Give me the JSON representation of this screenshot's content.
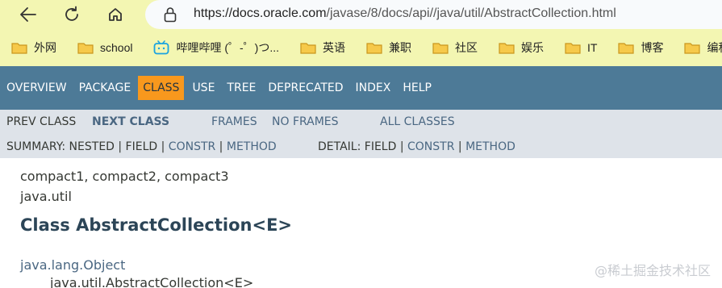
{
  "browser": {
    "url_host": "https://docs.oracle.com",
    "url_path": "/javase/8/docs/api//java/util/AbstractCollection.html",
    "back_icon": "arrow-left-icon",
    "reload_icon": "reload-icon",
    "home_icon": "home-icon",
    "lock_icon": "lock-icon"
  },
  "bookmarks": [
    {
      "label": "外网",
      "icon": "folder-icon"
    },
    {
      "label": "school",
      "icon": "folder-icon"
    },
    {
      "label": "哔哩哔哩 (゜-゜)つ...",
      "icon": "bilibili-icon"
    },
    {
      "label": "英语",
      "icon": "folder-icon"
    },
    {
      "label": "兼职",
      "icon": "folder-icon"
    },
    {
      "label": "社区",
      "icon": "folder-icon"
    },
    {
      "label": "娱乐",
      "icon": "folder-icon"
    },
    {
      "label": "IT",
      "icon": "folder-icon"
    },
    {
      "label": "博客",
      "icon": "folder-icon"
    },
    {
      "label": "编程",
      "icon": "folder-icon"
    }
  ],
  "topnav": {
    "overview": "OVERVIEW",
    "package": "PACKAGE",
    "class": "CLASS",
    "use": "USE",
    "tree": "TREE",
    "deprecated": "DEPRECATED",
    "index": "INDEX",
    "help": "HELP"
  },
  "subnav": {
    "prev_class": "PREV CLASS",
    "next_class": "NEXT CLASS",
    "frames": "FRAMES",
    "no_frames": "NO FRAMES",
    "all_classes": "ALL CLASSES",
    "summary_prefix": "SUMMARY: NESTED | FIELD | ",
    "summary_constr": "CONSTR",
    "summary_sep": " | ",
    "summary_method": "METHOD",
    "detail_prefix": "DETAIL: FIELD | ",
    "detail_constr": "CONSTR",
    "detail_sep": " | ",
    "detail_method": "METHOD"
  },
  "content": {
    "profiles": "compact1, compact2, compact3",
    "package": "java.util",
    "title": "Class AbstractCollection<E>",
    "parent_class": "java.lang.Object",
    "current_class": "java.util.AbstractCollection<E>"
  },
  "watermark": "@稀土掘金技术社区",
  "colors": {
    "browser_bar": "#f3f6b2",
    "nav_bg": "#4d7a97",
    "nav_active": "#f8981d",
    "subnav_bg": "#dee3e9",
    "link": "#4a6782",
    "title": "#2c4557"
  }
}
